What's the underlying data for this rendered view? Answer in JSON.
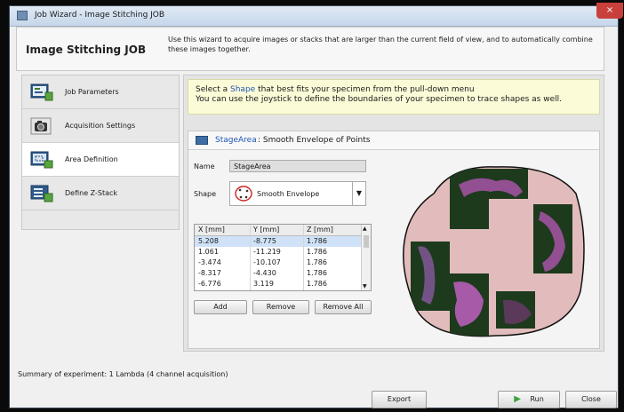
{
  "window": {
    "title": "Job Wizard - Image Stitching JOB",
    "close_glyph": "×"
  },
  "header": {
    "title": "Image Stitching JOB",
    "description": "Use this wizard to acquire images or stacks that are larger than the current field of view, and to automatically combine these images together."
  },
  "nav": {
    "items": [
      {
        "label": "Job Parameters",
        "icon": "job-parameters-icon"
      },
      {
        "label": "Acquisition Settings",
        "icon": "camera-icon"
      },
      {
        "label": "Area Definition",
        "icon": "area-definition-icon",
        "active": true
      },
      {
        "label": "Define Z-Stack",
        "icon": "z-stack-icon"
      }
    ]
  },
  "hint": {
    "prefix": "Select a ",
    "link": "Shape",
    "line1_suffix": " that best fits your specimen from the pull-down menu",
    "line2": "You can use the joystick to define the boundaries of your specimen to trace shapes as well."
  },
  "area": {
    "title_link": "StageArea",
    "title_rest": ": Smooth Envelope of Points",
    "name_label": "Name",
    "name_value": "StageArea",
    "shape_label": "Shape",
    "shape_value": "Smooth Envelope"
  },
  "table": {
    "headers": [
      "X [mm]",
      "Y [mm]",
      "Z [mm]"
    ],
    "rows": [
      [
        "5.208",
        "-8.775",
        "1.786"
      ],
      [
        "1.061",
        "-11.219",
        "1.786"
      ],
      [
        "-3.474",
        "-10.107",
        "1.786"
      ],
      [
        "-8.317",
        "-4.430",
        "1.786"
      ],
      [
        "-6.776",
        "3.119",
        "1.786"
      ]
    ],
    "selected_row": 0
  },
  "buttons": {
    "add": "Add",
    "remove": "Remove",
    "remove_all": "Remove All"
  },
  "summary": "Summary of experiment: 1 Lambda (4 channel acquisition)",
  "footer": {
    "export": "Export",
    "run": "Run",
    "close": "Close"
  },
  "colors": {
    "envelope_fill": "#e2bcbc",
    "tile": "#1d3a1d",
    "tissue": "#b055b0",
    "link": "#1f55b5"
  }
}
